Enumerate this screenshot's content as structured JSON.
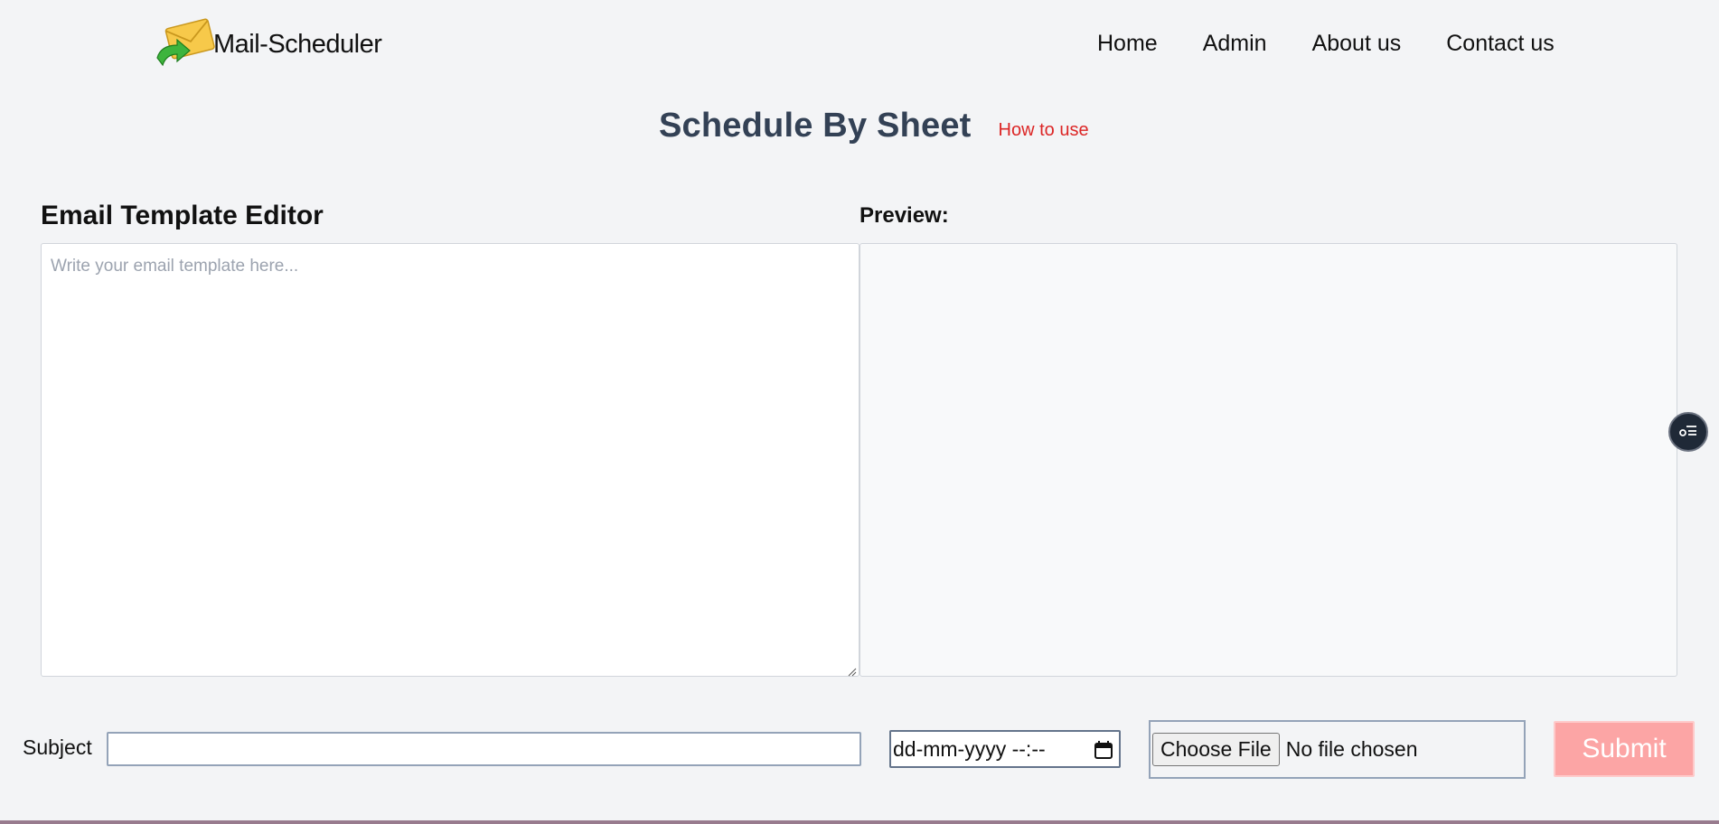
{
  "header": {
    "brand_name": "Mail-Scheduler",
    "logo_icon": "envelope-with-green-arrow-icon",
    "nav": [
      {
        "label": "Home"
      },
      {
        "label": "Admin"
      },
      {
        "label": "About us"
      },
      {
        "label": "Contact us"
      }
    ]
  },
  "main": {
    "title": "Schedule By Sheet",
    "how_to_use": "How to use"
  },
  "editor": {
    "heading": "Email Template Editor",
    "placeholder": "Write your email template here...",
    "value": ""
  },
  "preview": {
    "heading": "Preview:",
    "content": ""
  },
  "form": {
    "subject_label": "Subject",
    "subject_value": "",
    "datetime_placeholder": "dd-mm-yyyy --:--",
    "file_button": "Choose File",
    "file_status": "No file chosen",
    "submit_label": "Submit"
  },
  "floating_button": {
    "icon": "filter-list-icon"
  },
  "colors": {
    "background": "#f3f4f6",
    "title": "#334155",
    "link": "#dc2626",
    "submit_bg": "#fca5a5",
    "float_bg": "#1f2937"
  }
}
